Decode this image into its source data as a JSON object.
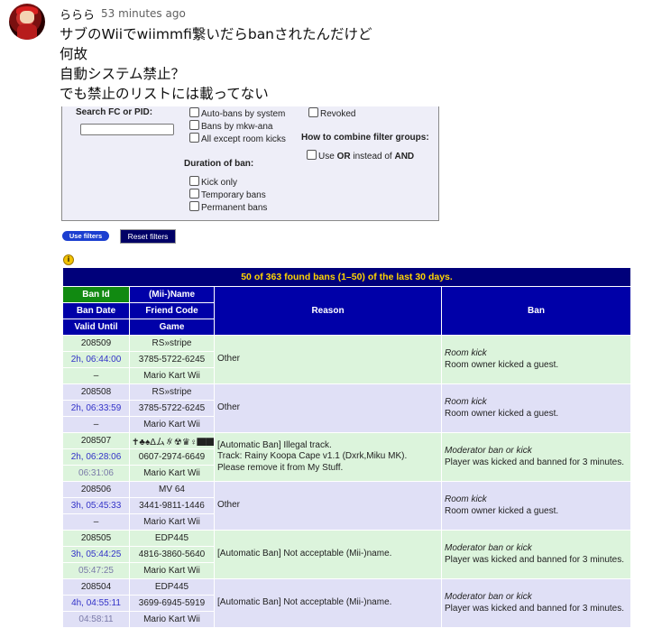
{
  "comment": {
    "author": "ららら",
    "time": "53 minutes ago",
    "lines": [
      "サブのWiiでwiimmfi繋いだらbanされたんだけど",
      "何故",
      "自動システム禁止？",
      "でも禁止のリストには載ってない"
    ]
  },
  "filters": {
    "search_label": "Search FC or PID:",
    "search_value": "",
    "options_col1": [
      "Auto-bans by system",
      "Bans by mkw-ana",
      "All except room kicks"
    ],
    "duration_label": "Duration of ban:",
    "duration_options": [
      "Kick only",
      "Temporary bans",
      "Permanent bans"
    ],
    "revoked_label": "Revoked",
    "combine_label": "How to combine filter groups:",
    "combine_pre": "Use ",
    "combine_or": "OR",
    "combine_mid": " instead of ",
    "combine_and": "AND",
    "use_filters": "Use filters",
    "reset_filters": "Reset filters"
  },
  "table": {
    "title": "50 of 363 found bans (1–50) of the last 30 days.",
    "headers": {
      "ban_id": "Ban Id",
      "mii_name": "(Mii-)Name",
      "ban_date": "Ban Date",
      "friend_code": "Friend Code",
      "valid_until": "Valid Until",
      "game": "Game",
      "reason": "Reason",
      "ban": "Ban"
    },
    "rows": [
      {
        "id": "208509",
        "name": "RS»stripe",
        "date": "2h, 06:44:00",
        "fc": "3785-5722-6245",
        "valid": "–",
        "game": "Mario Kart Wii",
        "reason": "Other",
        "ban_type": "Room kick",
        "ban_desc": "Room owner kicked a guest."
      },
      {
        "id": "208508",
        "name": "RS»stripe",
        "date": "2h, 06:33:59",
        "fc": "3785-5722-6245",
        "valid": "–",
        "game": "Mario Kart Wii",
        "reason": "Other",
        "ban_type": "Room kick",
        "ban_desc": "Room owner kicked a guest."
      },
      {
        "id": "208507",
        "name": "✝♣♠Δム∦☢♛♀▇▇",
        "date": "2h, 06:28:06",
        "fc": "0607-2974-6649",
        "valid": "06:31:06",
        "game": "Mario Kart Wii",
        "reason": "[Automatic Ban] Illegal track.\nTrack: Rainy Koopa Cape v1.1 (Dxrk,Miku MK).\nPlease remove it from My Stuff.",
        "ban_type": "Moderator ban or kick",
        "ban_desc": "Player was kicked and banned for 3 minutes."
      },
      {
        "id": "208506",
        "name": "MV 64",
        "date": "3h, 05:45:33",
        "fc": "3441-9811-1446",
        "valid": "–",
        "game": "Mario Kart Wii",
        "reason": "Other",
        "ban_type": "Room kick",
        "ban_desc": "Room owner kicked a guest."
      },
      {
        "id": "208505",
        "name": "EDP445",
        "date": "3h, 05:44:25",
        "fc": "4816-3860-5640",
        "valid": "05:47:25",
        "game": "Mario Kart Wii",
        "reason": "[Automatic Ban] Not acceptable (Mii-)name.",
        "ban_type": "Moderator ban or kick",
        "ban_desc": "Player was kicked and banned for 3 minutes."
      },
      {
        "id": "208504",
        "name": "EDP445",
        "date": "4h, 04:55:11",
        "fc": "3699-6945-5919",
        "valid": "04:58:11",
        "game": "Mario Kart Wii",
        "reason": "[Automatic Ban] Not acceptable (Mii-)name.",
        "ban_type": "Moderator ban or kick",
        "ban_desc": "Player was kicked and banned for 3 minutes."
      }
    ]
  }
}
